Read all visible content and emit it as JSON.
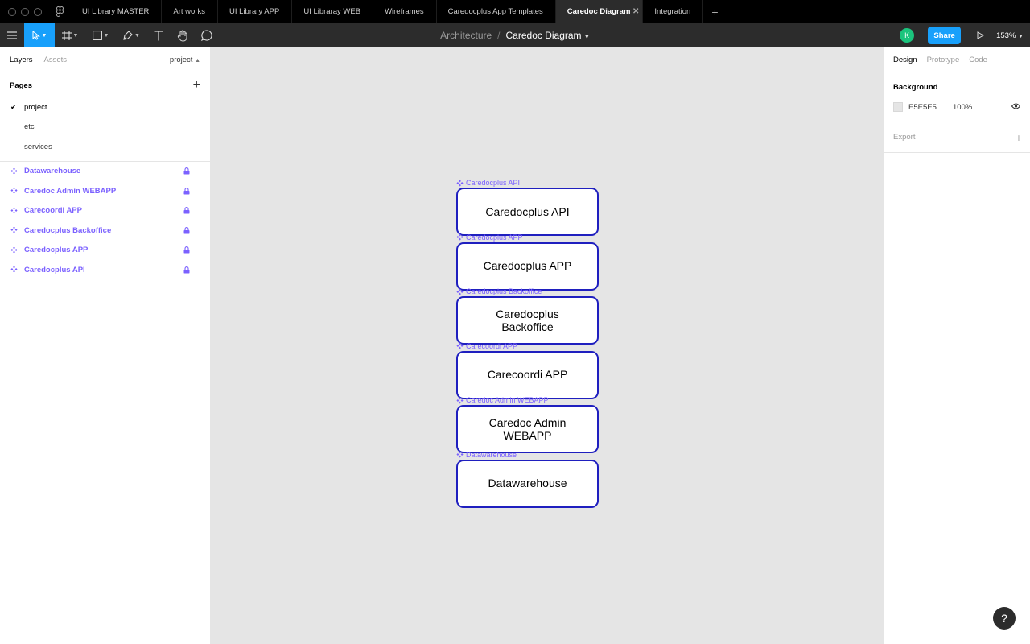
{
  "tabs": [
    {
      "label": "UI Library MASTER"
    },
    {
      "label": "Art works"
    },
    {
      "label": "UI Library APP"
    },
    {
      "label": "UI Libraray WEB"
    },
    {
      "label": "Wireframes"
    },
    {
      "label": "Caredocplus App Templates"
    },
    {
      "label": "Caredoc Diagram",
      "active": true
    },
    {
      "label": "Integration"
    }
  ],
  "toolbar": {
    "breadcrumb_parent": "Architecture",
    "breadcrumb_sep": "/",
    "file_name": "Caredoc Diagram",
    "avatar_initial": "K",
    "share_label": "Share",
    "zoom": "153%",
    "active_tool": "move"
  },
  "left_panel": {
    "tab_layers": "Layers",
    "tab_assets": "Assets",
    "current_page": "project",
    "pages_title": "Pages",
    "pages": [
      {
        "label": "project",
        "current": true
      },
      {
        "label": "etc"
      },
      {
        "label": "services"
      }
    ],
    "layers": [
      {
        "label": "Datawarehouse"
      },
      {
        "label": "Caredoc Admin WEBAPP"
      },
      {
        "label": "Carecoordi APP"
      },
      {
        "label": "Caredocplus Backoffice"
      },
      {
        "label": "Caredocplus APP"
      },
      {
        "label": "Caredocplus API"
      }
    ]
  },
  "canvas": {
    "components": [
      {
        "label": "Caredocplus API",
        "text": "Caredocplus API"
      },
      {
        "label": "Caredocplus APP",
        "text": "Caredocplus APP"
      },
      {
        "label": "Caredocplus Backoffice",
        "text": "Caredocplus Backoffice"
      },
      {
        "label": "Carecoordi APP",
        "text": "Carecoordi APP"
      },
      {
        "label": "Caredoc Admin WEBAPP",
        "text": "Caredoc Admin WEBAPP"
      },
      {
        "label": "Datawarehouse",
        "text": "Datawarehouse"
      }
    ]
  },
  "right_panel": {
    "tab_design": "Design",
    "tab_prototype": "Prototype",
    "tab_code": "Code",
    "background_title": "Background",
    "background_hex": "E5E5E5",
    "background_opacity": "100%",
    "export_title": "Export"
  },
  "help_label": "?",
  "colors": {
    "accent": "#18a0fb",
    "component": "#7b61ff",
    "node_border": "#1f1fbf",
    "canvas_bg": "#e5e5e5"
  }
}
